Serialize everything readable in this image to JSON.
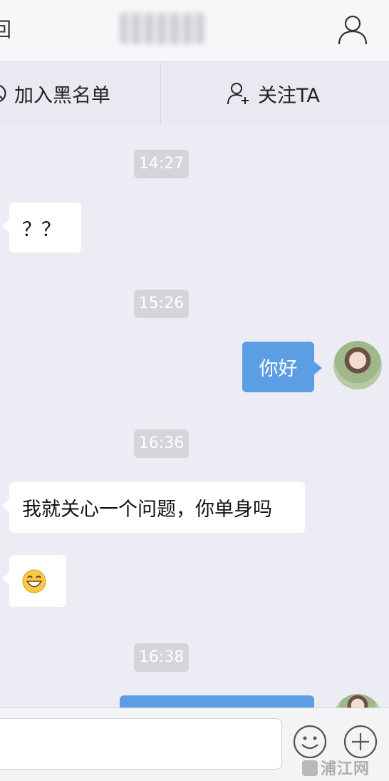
{
  "nav": {
    "back_label": "回"
  },
  "actions": {
    "block_label": "加入黑名单",
    "follow_label": "关注TA"
  },
  "messages": [
    {
      "type": "timestamp",
      "text": "14:27"
    },
    {
      "type": "received",
      "text": "？？"
    },
    {
      "type": "timestamp",
      "text": "15:26"
    },
    {
      "type": "sent",
      "text": "你好"
    },
    {
      "type": "timestamp",
      "text": "16:36"
    },
    {
      "type": "received",
      "text": "我就关心一个问题，你单身吗"
    },
    {
      "type": "received",
      "text": "😄"
    },
    {
      "type": "timestamp",
      "text": "16:38"
    },
    {
      "type": "sent",
      "text": ""
    }
  ],
  "input": {
    "placeholder": ""
  },
  "watermark": "浦江网",
  "colors": {
    "background": "#ececf4",
    "sent_bubble": "#5c9ee4",
    "received_bubble": "#ffffff",
    "timestamp_bg": "#d4d4d9"
  },
  "icons": [
    "profile-icon",
    "add-person-icon",
    "block-icon",
    "emoji-icon",
    "plus-icon"
  ]
}
